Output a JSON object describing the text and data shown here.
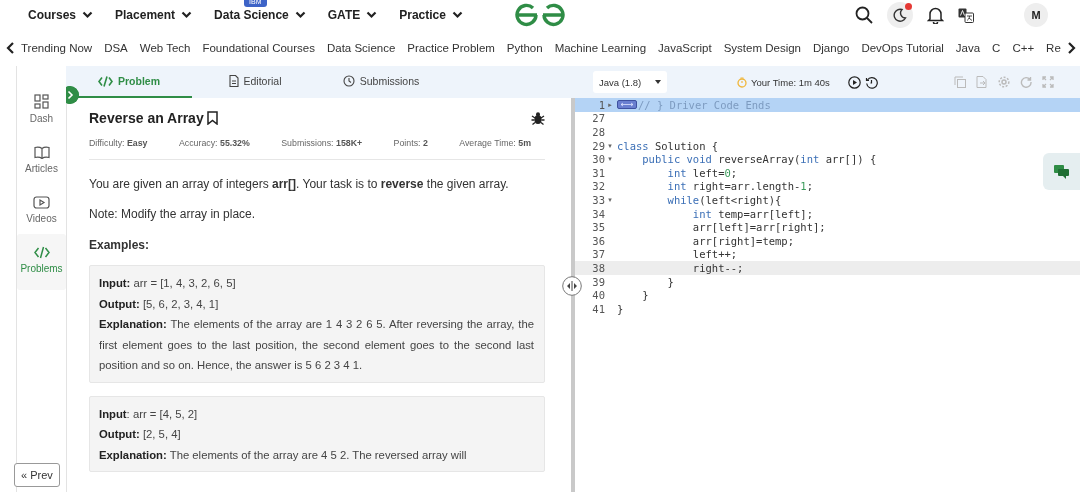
{
  "top_nav": {
    "menus": [
      {
        "label": "Courses"
      },
      {
        "label": "Placement"
      },
      {
        "label": "Data Science",
        "badge": "IBM"
      },
      {
        "label": "GATE"
      },
      {
        "label": "Practice"
      }
    ],
    "avatar": "M"
  },
  "sub_nav": {
    "items": [
      "Trending Now",
      "DSA",
      "Web Tech",
      "Foundational Courses",
      "Data Science",
      "Practice Problem",
      "Python",
      "Machine Learning",
      "JavaScript",
      "System Design",
      "Django",
      "DevOps Tutorial",
      "Java",
      "C",
      "C++",
      "Re"
    ]
  },
  "sidebar": {
    "items": [
      {
        "label": "Dash",
        "selected": false
      },
      {
        "label": "Articles",
        "selected": false
      },
      {
        "label": "Videos",
        "selected": false
      },
      {
        "label": "Problems",
        "selected": true
      }
    ],
    "prev_button": "« Prev"
  },
  "problem_tabs": [
    {
      "label": "Problem",
      "selected": true
    },
    {
      "label": "Editorial",
      "selected": false
    },
    {
      "label": "Submissions",
      "selected": false
    }
  ],
  "problem": {
    "title": "Reverse an Array",
    "stats": [
      "Difficulty: **Easy**",
      "Accuracy: **55.32%**",
      "Submissions: **158K+**",
      "Points: **2**",
      "Average Time: **5m**"
    ],
    "statement": "You are given an array of integers **arr[]**. Your task is to **reverse** the given array.",
    "note": "Note: Modify the array in place.",
    "examples_heading": "Examples:",
    "examples": [
      {
        "input": "**Input:** arr = [1, 4, 3, 2, 6, 5]",
        "output": "**Output:** [5, 6, 2, 3, 4, 1]",
        "explanation": "**Explanation:** The elements of the array are 1 4 3 2 6 5. After reversing the array, the first element goes to the last position, the second element goes to the second last position and so on. Hence, the answer is 5 6 2 3 4 1."
      },
      {
        "input": "**Input**: arr = [4, 5, 2]",
        "output": "**Output:** [2, 5, 4]",
        "explanation": "**Explanation:** The elements of the array are 4 5 2. The reversed array will"
      }
    ]
  },
  "editor": {
    "language": "Java (1.8)",
    "timer": "Your Time: 1m 40s",
    "lines": [
      {
        "number": "1",
        "fold": "▸",
        "selected": true,
        "current": false,
        "folded_widget": true,
        "tokens": [
          {
            "text": "// } Driver Code Ends",
            "kind": "comment"
          }
        ]
      },
      {
        "number": "27",
        "selected": false,
        "current": false
      },
      {
        "number": "28",
        "selected": false,
        "current": false
      },
      {
        "number": "29",
        "fold": "▾",
        "selected": false,
        "current": false,
        "tokens": [
          {
            "text": "class",
            "kind": "keyword"
          },
          {
            "text": " Solution {",
            "kind": "plain"
          }
        ]
      },
      {
        "number": "30",
        "fold": "▾",
        "selected": false,
        "current": false,
        "tokens": [
          {
            "text": "    public",
            "kind": "keyword"
          },
          {
            "text": " void",
            "kind": "keyword"
          },
          {
            "text": " reverseArray(",
            "kind": "plain"
          },
          {
            "text": "int",
            "kind": "keyword"
          },
          {
            "text": " arr[]) {",
            "kind": "plain"
          }
        ]
      },
      {
        "number": "31",
        "selected": false,
        "current": false,
        "tokens": [
          {
            "text": "        int",
            "kind": "keyword"
          },
          {
            "text": " left=",
            "kind": "plain"
          },
          {
            "text": "0",
            "kind": "number"
          },
          {
            "text": ";",
            "kind": "plain"
          }
        ]
      },
      {
        "number": "32",
        "selected": false,
        "current": false,
        "tokens": [
          {
            "text": "        int",
            "kind": "keyword"
          },
          {
            "text": " right=arr.length-",
            "kind": "plain"
          },
          {
            "text": "1",
            "kind": "number"
          },
          {
            "text": ";",
            "kind": "plain"
          }
        ]
      },
      {
        "number": "33",
        "fold": "▾",
        "selected": false,
        "current": false,
        "tokens": [
          {
            "text": "        while",
            "kind": "keyword"
          },
          {
            "text": "(left<right){",
            "kind": "plain"
          }
        ]
      },
      {
        "number": "34",
        "selected": false,
        "current": false,
        "tokens": [
          {
            "text": "            int",
            "kind": "keyword"
          },
          {
            "text": " temp=arr[left];",
            "kind": "plain"
          }
        ]
      },
      {
        "number": "35",
        "selected": false,
        "current": false,
        "tokens": [
          {
            "text": "            arr[left]=arr[right];",
            "kind": "plain"
          }
        ]
      },
      {
        "number": "36",
        "selected": false,
        "current": false,
        "tokens": [
          {
            "text": "            arr[right]=temp;",
            "kind": "plain"
          }
        ]
      },
      {
        "number": "37",
        "selected": false,
        "current": false,
        "tokens": [
          {
            "text": "            left++;",
            "kind": "plain"
          }
        ]
      },
      {
        "number": "38",
        "selected": false,
        "current": true,
        "tokens": [
          {
            "text": "            right--;",
            "kind": "plain"
          }
        ]
      },
      {
        "number": "39",
        "selected": false,
        "current": false,
        "tokens": [
          {
            "text": "        }",
            "kind": "plain"
          }
        ]
      },
      {
        "number": "40",
        "selected": false,
        "current": false,
        "tokens": [
          {
            "text": "    }",
            "kind": "plain"
          }
        ]
      },
      {
        "number": "41",
        "selected": false,
        "current": false,
        "tokens": [
          {
            "text": "}",
            "kind": "plain"
          }
        ]
      }
    ]
  }
}
